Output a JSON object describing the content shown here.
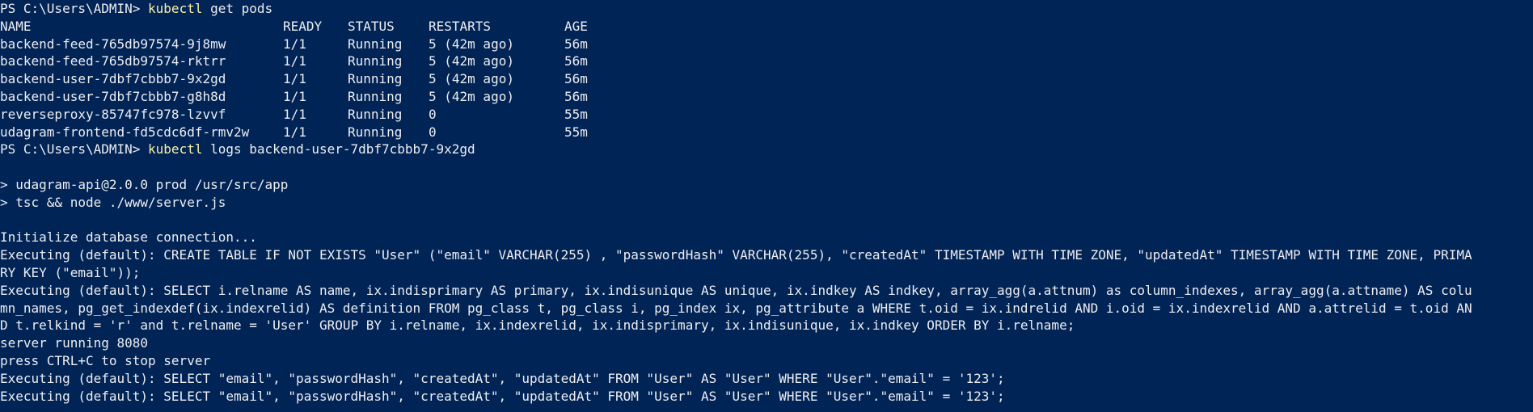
{
  "colors": {
    "background": "#012456",
    "text": "#eeedf0",
    "command": "#f9f1a5"
  },
  "prompt1": {
    "prompt": "PS C:\\Users\\ADMIN> ",
    "cmd": "kubectl",
    "args": " get pods"
  },
  "pods": {
    "headers": {
      "name": "NAME",
      "ready": "READY",
      "status": "STATUS",
      "restarts": "RESTARTS",
      "age": "AGE"
    },
    "rows": [
      {
        "name": "backend-feed-765db97574-9j8mw",
        "ready": "1/1",
        "status": "Running",
        "restarts": "5 (42m ago)",
        "age": "56m"
      },
      {
        "name": "backend-feed-765db97574-rktrr",
        "ready": "1/1",
        "status": "Running",
        "restarts": "5 (42m ago)",
        "age": "56m"
      },
      {
        "name": "backend-user-7dbf7cbbb7-9x2gd",
        "ready": "1/1",
        "status": "Running",
        "restarts": "5 (42m ago)",
        "age": "56m"
      },
      {
        "name": "backend-user-7dbf7cbbb7-g8h8d",
        "ready": "1/1",
        "status": "Running",
        "restarts": "5 (42m ago)",
        "age": "56m"
      },
      {
        "name": "reverseproxy-85747fc978-lzvvf",
        "ready": "1/1",
        "status": "Running",
        "restarts": "0",
        "age": "55m"
      },
      {
        "name": "udagram-frontend-fd5cdc6df-rmv2w",
        "ready": "1/1",
        "status": "Running",
        "restarts": "0",
        "age": "55m"
      }
    ]
  },
  "prompt2": {
    "prompt": "PS C:\\Users\\ADMIN> ",
    "cmd": "kubectl",
    "args": " logs backend-user-7dbf7cbbb7-9x2gd"
  },
  "logs": [
    "",
    "> udagram-api@2.0.0 prod /usr/src/app",
    "> tsc && node ./www/server.js",
    "",
    "Initialize database connection...",
    "Executing (default): CREATE TABLE IF NOT EXISTS \"User\" (\"email\" VARCHAR(255) , \"passwordHash\" VARCHAR(255), \"createdAt\" TIMESTAMP WITH TIME ZONE, \"updatedAt\" TIMESTAMP WITH TIME ZONE, PRIMA",
    "RY KEY (\"email\"));",
    "Executing (default): SELECT i.relname AS name, ix.indisprimary AS primary, ix.indisunique AS unique, ix.indkey AS indkey, array_agg(a.attnum) as column_indexes, array_agg(a.attname) AS colu",
    "mn_names, pg_get_indexdef(ix.indexrelid) AS definition FROM pg_class t, pg_class i, pg_index ix, pg_attribute a WHERE t.oid = ix.indrelid AND i.oid = ix.indexrelid AND a.attrelid = t.oid AN",
    "D t.relkind = 'r' and t.relname = 'User' GROUP BY i.relname, ix.indexrelid, ix.indisprimary, ix.indisunique, ix.indkey ORDER BY i.relname;",
    "server running 8080",
    "press CTRL+C to stop server",
    "Executing (default): SELECT \"email\", \"passwordHash\", \"createdAt\", \"updatedAt\" FROM \"User\" AS \"User\" WHERE \"User\".\"email\" = '123';",
    "Executing (default): SELECT \"email\", \"passwordHash\", \"createdAt\", \"updatedAt\" FROM \"User\" AS \"User\" WHERE \"User\".\"email\" = '123';"
  ]
}
